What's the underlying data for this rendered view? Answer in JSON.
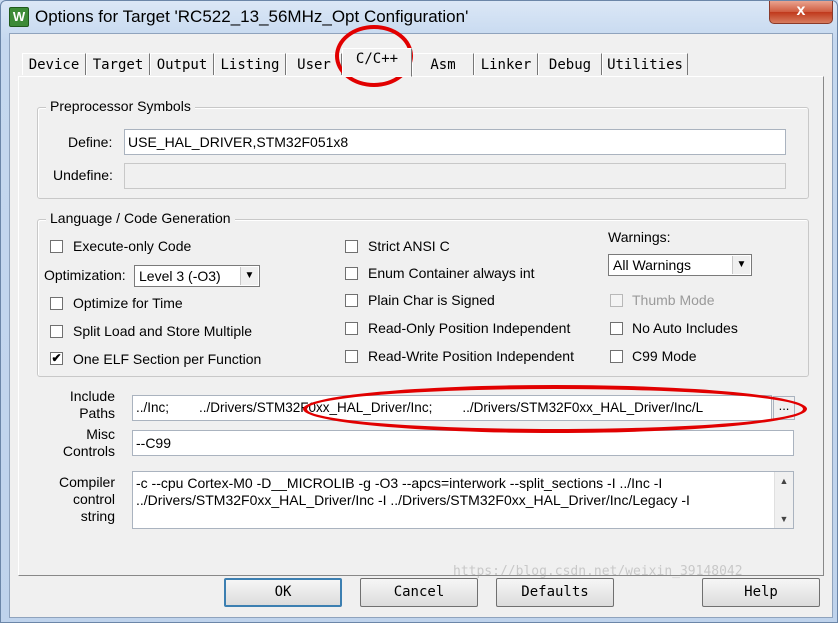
{
  "window": {
    "title": "Options for Target 'RC522_13_56MHz_Opt Configuration'",
    "app_icon_glyph": "W",
    "close_glyph": "x"
  },
  "tabs": [
    {
      "label": "Device"
    },
    {
      "label": "Target"
    },
    {
      "label": "Output"
    },
    {
      "label": "Listing"
    },
    {
      "label": "User"
    },
    {
      "label": "C/C++",
      "active": true
    },
    {
      "label": "Asm"
    },
    {
      "label": "Linker"
    },
    {
      "label": "Debug"
    },
    {
      "label": "Utilities"
    }
  ],
  "preprocessor": {
    "group_label": "Preprocessor Symbols",
    "define_label": "Define:",
    "define_value": "USE_HAL_DRIVER,STM32F051x8",
    "undefine_label": "Undefine:",
    "undefine_value": ""
  },
  "language": {
    "group_label": "Language / Code Generation",
    "execute_only": {
      "label": "Execute-only Code",
      "checked": false
    },
    "optimization_label": "Optimization:",
    "optimization_value": "Level 3 (-O3)",
    "optimize_time": {
      "label": "Optimize for Time",
      "checked": false
    },
    "split_load": {
      "label": "Split Load and Store Multiple",
      "checked": false
    },
    "one_elf": {
      "label": "One ELF Section per Function",
      "checked": true
    },
    "strict_ansi": {
      "label": "Strict ANSI C",
      "checked": false
    },
    "enum_container": {
      "label": "Enum Container always int",
      "checked": false
    },
    "plain_char": {
      "label": "Plain Char is Signed",
      "checked": false
    },
    "ropi": {
      "label": "Read-Only Position Independent",
      "checked": false
    },
    "rwpi": {
      "label": "Read-Write Position Independent",
      "checked": false
    },
    "warnings_label": "Warnings:",
    "warnings_value": "All Warnings",
    "thumb_mode": {
      "label": "Thumb Mode",
      "checked": false,
      "disabled": true
    },
    "no_auto_includes": {
      "label": "No Auto Includes",
      "checked": false
    },
    "c99_mode": {
      "label": "C99 Mode",
      "checked": false
    },
    "check_glyph": "✔"
  },
  "paths": {
    "include_label_1": "Include",
    "include_label_2": "Paths",
    "include_value": "../Inc;        ../Drivers/STM32F0xx_HAL_Driver/Inc;        ../Drivers/STM32F0xx_HAL_Driver/Inc/L",
    "browse_label": "...",
    "misc_label_1": "Misc",
    "misc_label_2": "Controls",
    "misc_value": "--C99",
    "compiler_label_1": "Compiler",
    "compiler_label_2": "control",
    "compiler_label_3": "string",
    "compiler_line_1": "-c --cpu Cortex-M0 -D__MICROLIB -g -O3 --apcs=interwork --split_sections -I ../Inc -I",
    "compiler_line_2": "../Drivers/STM32F0xx_HAL_Driver/Inc -I ../Drivers/STM32F0xx_HAL_Driver/Inc/Legacy -I",
    "scroll_up": "▲",
    "scroll_down": "▼"
  },
  "buttons": {
    "ok": "OK",
    "cancel": "Cancel",
    "defaults": "Defaults",
    "help": "Help"
  },
  "dropdown_arrow": "▼",
  "watermark": "https://blog.csdn.net/weixin_39148042",
  "colors": {
    "annotation_red": "#e10000",
    "title_bar": "#c5d8ef",
    "dialog_bg": "#f0f0f0"
  }
}
